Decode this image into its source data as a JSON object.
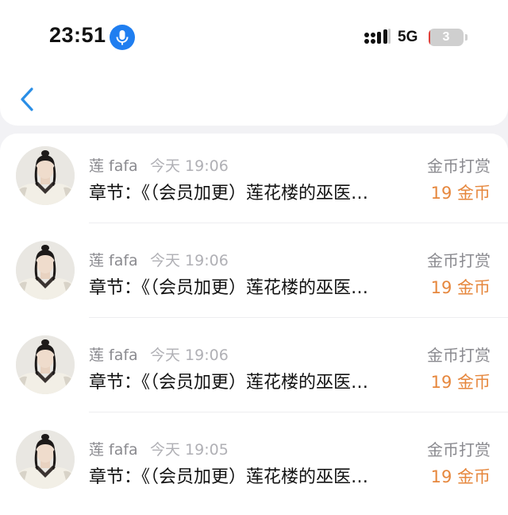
{
  "status_bar": {
    "time": "23:51",
    "network": "5G",
    "battery": "3",
    "battery_level": 0.03,
    "colors": {
      "mic": "#1f7ef0",
      "battery_low": "#e0403a"
    }
  },
  "nav": {
    "back_icon": "chevron-left-icon",
    "accent": "#2a8ee6"
  },
  "records": [
    {
      "name": "莲 fafa",
      "time": "今天 19:06",
      "type": "金币打赏",
      "chapter": "章节：《（会员加更）莲花楼的巫医…",
      "amount": "19 金币"
    },
    {
      "name": "莲 fafa",
      "time": "今天 19:06",
      "type": "金币打赏",
      "chapter": "章节：《（会员加更）莲花楼的巫医…",
      "amount": "19 金币"
    },
    {
      "name": "莲 fafa",
      "time": "今天 19:06",
      "type": "金币打赏",
      "chapter": "章节：《（会员加更）莲花楼的巫医…",
      "amount": "19 金币"
    },
    {
      "name": "莲 fafa",
      "time": "今天 19:05",
      "type": "金币打赏",
      "chapter": "章节：《（会员加更）莲花楼的巫医…",
      "amount": "19 金币"
    }
  ],
  "colors": {
    "amount": "#e6873d",
    "secondary_text": "#8a8a8f"
  }
}
